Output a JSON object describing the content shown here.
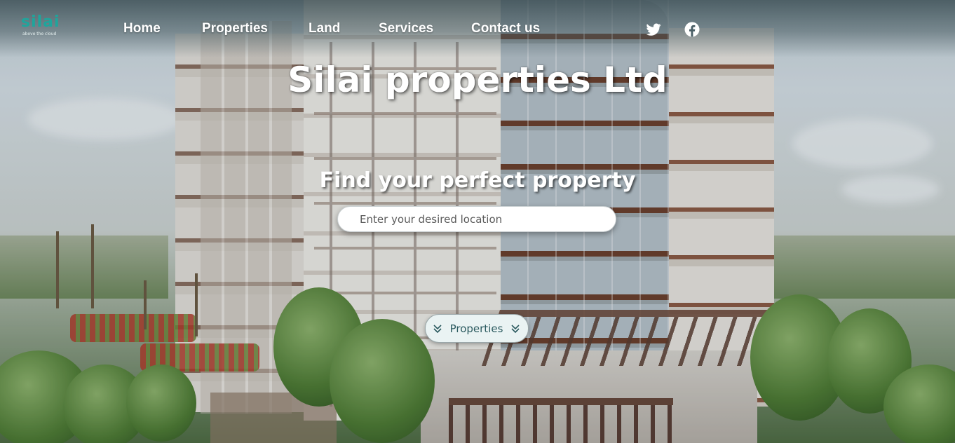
{
  "logo": {
    "name": "silai",
    "tagline": "above the cloud"
  },
  "nav": {
    "items": [
      {
        "label": "Home"
      },
      {
        "label": "Properties"
      },
      {
        "label": "Land"
      },
      {
        "label": "Services"
      },
      {
        "label": "Contact us"
      }
    ],
    "social": [
      "twitter-icon",
      "facebook-icon"
    ]
  },
  "hero": {
    "title": "Silai properties Ltd",
    "subtitle": "Find your perfect property",
    "search_placeholder": "Enter your desired location",
    "button_label": "Properties"
  },
  "colors": {
    "brand_teal": "#1fa59c",
    "button_text": "#2b5a5f",
    "button_bg": "#eaf3f3"
  }
}
